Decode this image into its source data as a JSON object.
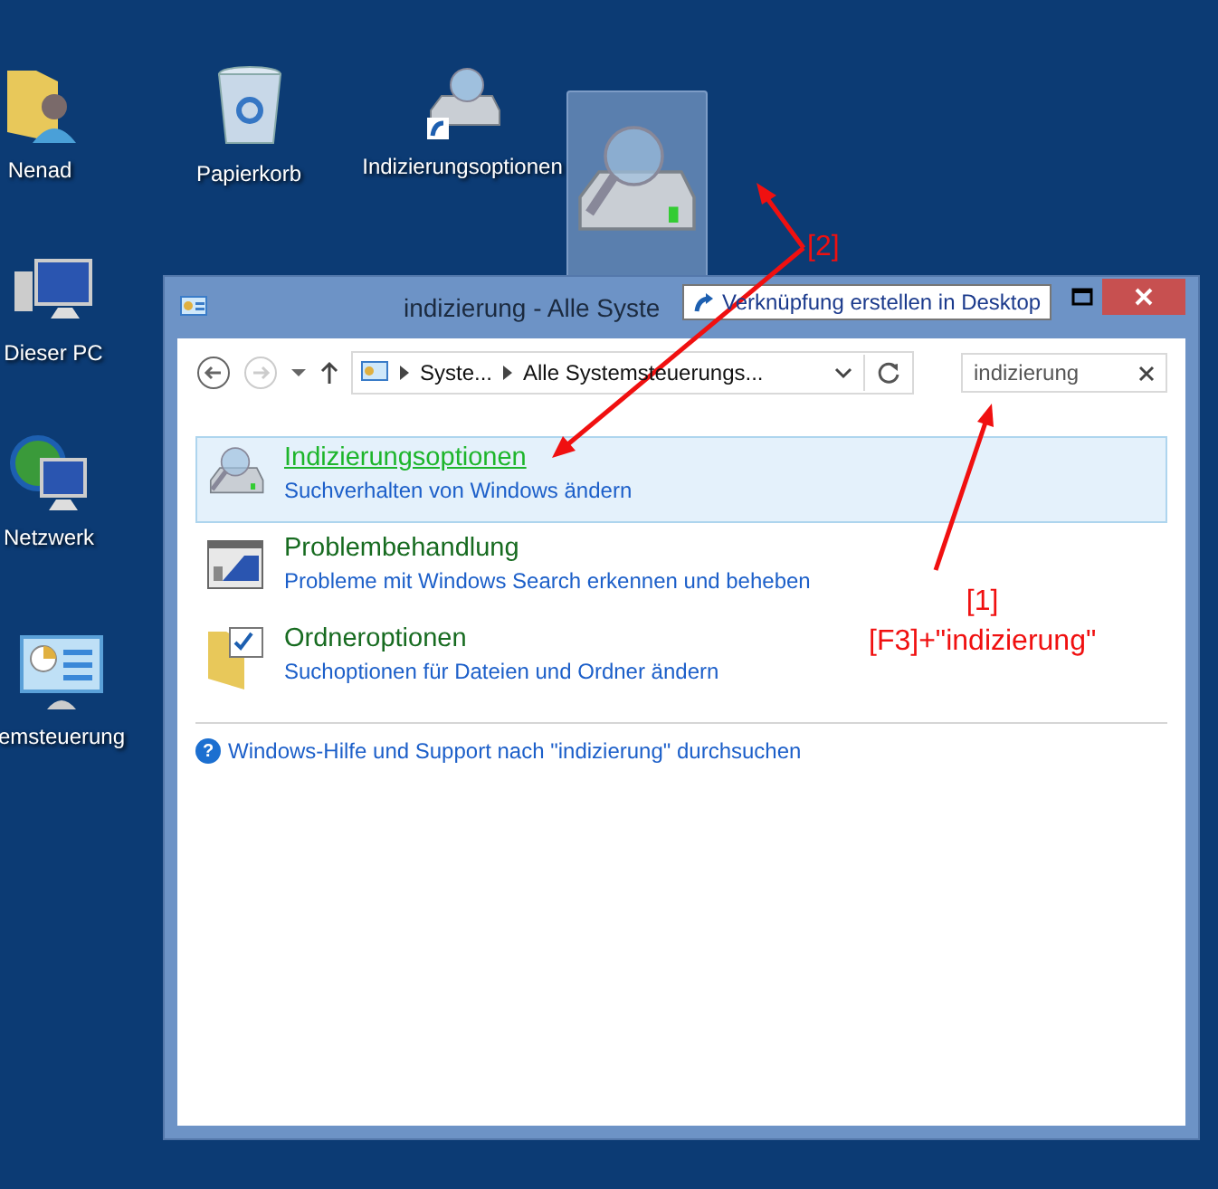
{
  "desktop_icons": [
    {
      "label": "Nenad",
      "kind": "user"
    },
    {
      "label": "Papierkorb",
      "kind": "trash"
    },
    {
      "label": "Indizierungsoptionen",
      "kind": "index-shortcut"
    },
    {
      "label": "Dieser PC",
      "kind": "pc"
    },
    {
      "label": "Netzwerk",
      "kind": "network"
    },
    {
      "label": "emsteuerung",
      "kind": "control-panel"
    }
  ],
  "dragged_icon": {
    "kind": "index-drive"
  },
  "window": {
    "title": "indizierung - Alle Syste",
    "tooltip": "Verknüpfung erstellen in Desktop",
    "breadcrumb": [
      "Syste...",
      "Alle Systemsteuerungs..."
    ],
    "search": {
      "value": "indizierung"
    },
    "results": [
      {
        "title": "Indizierungsoptionen",
        "subtitle": "Suchverhalten von Windows ändern",
        "kind": "index",
        "selected": true
      },
      {
        "title": "Problembehandlung",
        "subtitle": "Probleme mit Windows Search erkennen und beheben",
        "kind": "troubleshoot",
        "selected": false
      },
      {
        "title": "Ordneroptionen",
        "subtitle": "Suchoptionen für Dateien und Ordner ändern",
        "kind": "folder",
        "selected": false
      }
    ],
    "help_icon": "?",
    "help_link": "Windows-Hilfe und Support nach \"indizierung\" durchsuchen"
  },
  "annotations": [
    {
      "lines": [
        "[2]"
      ],
      "kind": "two-arrows"
    },
    {
      "lines": [
        "[1]",
        "[F3]+\"indizierung\""
      ],
      "kind": "one-arrow"
    }
  ]
}
